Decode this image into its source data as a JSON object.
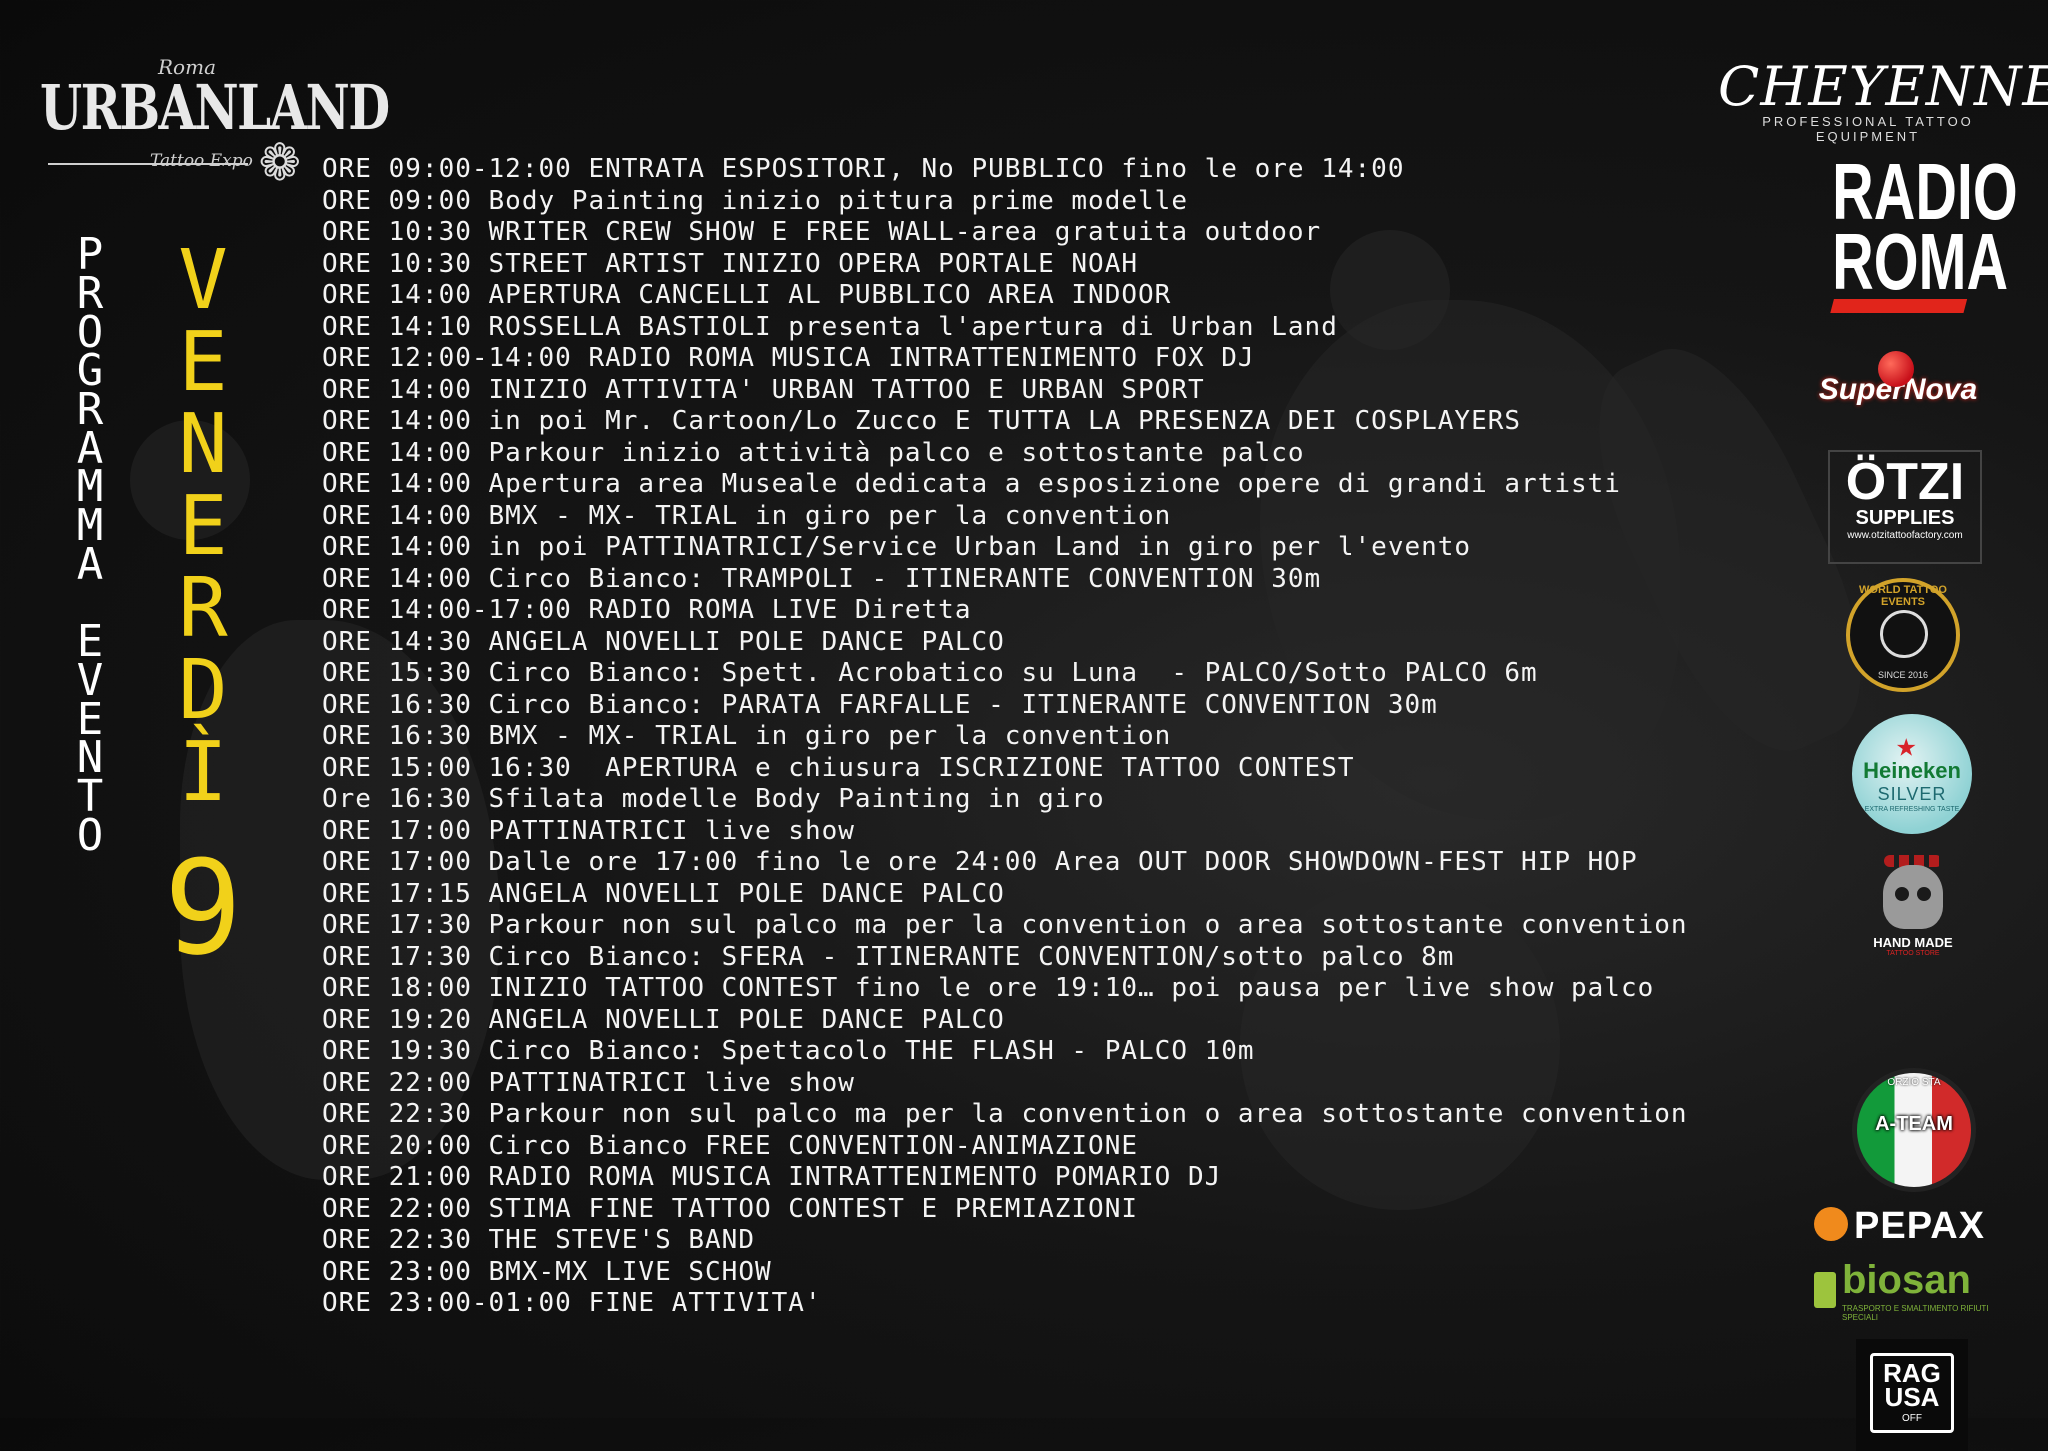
{
  "event_logo": {
    "city": "Roma",
    "name": "URBANLAND",
    "subtitle": "Tattoo Expo"
  },
  "vertical_title": [
    "P",
    "R",
    "O",
    "G",
    "R",
    "A",
    "M",
    "M",
    "A",
    "",
    "E",
    "V",
    "E",
    "N",
    "T",
    "O"
  ],
  "day": {
    "letters": [
      "V",
      "E",
      "N",
      "E",
      "R",
      "D",
      "Ì"
    ],
    "number": "9"
  },
  "schedule": [
    "ORE 09:00-12:00 ENTRATA ESPOSITORI, No PUBBLICO fino le ore 14:00",
    "ORE 09:00 Body Painting inizio pittura prime modelle",
    "ORE 10:30 WRITER CREW SHOW E FREE WALL-area gratuita outdoor",
    "ORE 10:30 STREET ARTIST INIZIO OPERA PORTALE NOAH",
    "ORE 14:00 APERTURA CANCELLI AL PUBBLICO AREA INDOOR",
    "ORE 14:10 ROSSELLA BASTIOLI presenta l'apertura di Urban Land",
    "ORE 12:00-14:00 RADIO ROMA MUSICA INTRATTENIMENTO FOX DJ",
    "ORE 14:00 INIZIO ATTIVITA' URBAN TATTOO E URBAN SPORT",
    "ORE 14:00 in poi Mr. Cartoon/Lo Zucco E TUTTA LA PRESENZA DEI COSPLAYERS",
    "ORE 14:00 Parkour inizio attività palco e sottostante palco",
    "ORE 14:00 Apertura area Museale dedicata a esposizione opere di grandi artisti",
    "ORE 14:00 BMX - MX- TRIAL in giro per la convention",
    "ORE 14:00 in poi PATTINATRICI/Service Urban Land in giro per l'evento",
    "ORE 14:00 Circo Bianco: TRAMPOLI - ITINERANTE CONVENTION 30m",
    "ORE 14:00-17:00 RADIO ROMA LIVE Diretta",
    "ORE 14:30 ANGELA NOVELLI POLE DANCE PALCO",
    "ORE 15:30 Circo Bianco: Spett. Acrobatico su Luna  - PALCO/Sotto PALCO 6m",
    "ORE 16:30 Circo Bianco: PARATA FARFALLE - ITINERANTE CONVENTION 30m",
    "ORE 16:30 BMX - MX- TRIAL in giro per la convention",
    "ORE 15:00 16:30  APERTURA e chiusura ISCRIZIONE TATTOO CONTEST",
    "Ore 16:30 Sfilata modelle Body Painting in giro",
    "ORE 17:00 PATTINATRICI live show",
    "ORE 17:00 Dalle ore 17:00 fino le ore 24:00 Area OUT DOOR SHOWDOWN-FEST HIP HOP",
    "ORE 17:15 ANGELA NOVELLI POLE DANCE PALCO",
    "ORE 17:30 Parkour non sul palco ma per la convention o area sottostante convention",
    "ORE 17:30 Circo Bianco: SFERA - ITINERANTE CONVENTION/sotto palco 8m",
    "ORE 18:00 INIZIO TATTOO CONTEST fino le ore 19:10… poi pausa per live show palco",
    "ORE 19:20 ANGELA NOVELLI POLE DANCE PALCO",
    "ORE 19:30 Circo Bianco: Spettacolo THE FLASH - PALCO 10m",
    "ORE 22:00 PATTINATRICI live show",
    "ORE 22:30 Parkour non sul palco ma per la convention o area sottostante convention",
    "ORE 20:00 Circo Bianco FREE CONVENTION-ANIMAZIONE",
    "ORE 21:00 RADIO ROMA MUSICA INTRATTENIMENTO POMARIO DJ",
    "ORE 22:00 STIMA FINE TATTOO CONTEST E PREMIAZIONI",
    "ORE 22:30 THE STEVE'S BAND",
    "ORE 23:00 BMX-MX LIVE SCHOW",
    "ORE 23:00-01:00 FINE ATTIVITA'"
  ],
  "sponsors": {
    "cheyenne": {
      "name": "CHEYENNE",
      "tagline": "PROFESSIONAL TATTOO EQUIPMENT"
    },
    "radio_roma": {
      "line1": "RADIO",
      "line2": "ROMA"
    },
    "supernova": {
      "name": "SuperNova"
    },
    "otzi": {
      "name": "ÖTZI",
      "line2": "SUPPLIES",
      "url": "www.otzitattoofactory.com"
    },
    "world_tattoo_events": {
      "name": "WORLD TATTOO EVENTS",
      "since": "SINCE 2016"
    },
    "heineken": {
      "name": "Heineken",
      "variant": "SILVER",
      "extra": "EXTRA REFRESHING TASTE"
    },
    "hand_made": {
      "name": "HAND MADE",
      "sub": "TATTOO STORE"
    },
    "a_team": {
      "name": "A-TEAM",
      "top": "ORZIO STA"
    },
    "pepax": {
      "name": "PEPAX"
    },
    "biosan": {
      "name": "biosan",
      "sub": "TRASPORTO E SMALTIMENTO RIFIUTI SPECIALI"
    },
    "ragusa_off": {
      "line1": "RAG",
      "line2": "USA",
      "line3": "OFF"
    }
  },
  "colors": {
    "accent_yellow": "#f1d11a",
    "radio_red": "#e1251b",
    "background": "#0f0f0f"
  }
}
